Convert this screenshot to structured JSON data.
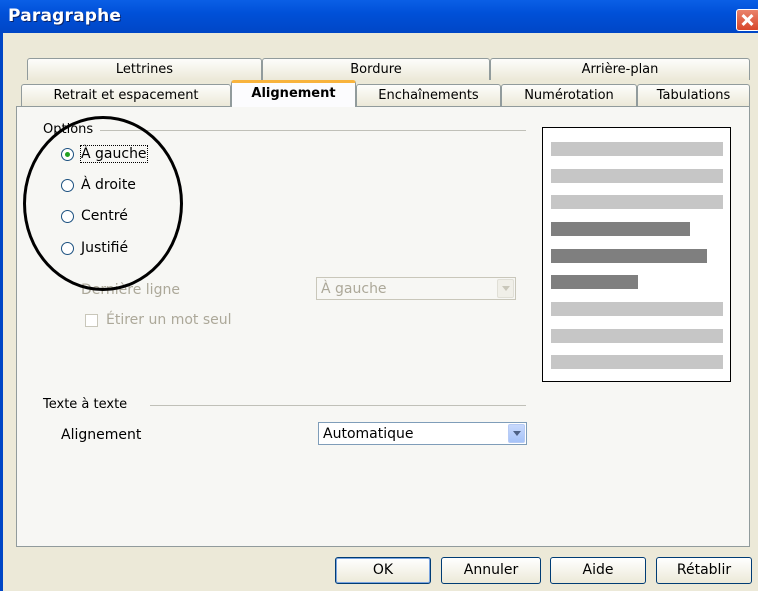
{
  "window": {
    "title": "Paragraphe"
  },
  "tabs_row1": [
    "Lettrines",
    "Bordure",
    "Arrière-plan"
  ],
  "tabs_row2": [
    "Retrait et espacement",
    "Alignement",
    "Enchaînements",
    "Numérotation",
    "Tabulations"
  ],
  "active_tab": "Alignement",
  "options": {
    "section_label": "Options",
    "radios": [
      "À gauche",
      "À droite",
      "Centré",
      "Justifié"
    ],
    "selected": "À gauche",
    "last_line_label": "Dernière ligne",
    "last_line_value": "À gauche",
    "stretch_word_label": "Étirer un mot seul",
    "stretch_word_checked": false
  },
  "text_to_text": {
    "section_label": "Texte à texte",
    "alignment_label": "Alignement",
    "alignment_value": "Automatique"
  },
  "preview": {
    "line_colors": {
      "context": "#c6c6c6",
      "paragraph": "#7f7f7f"
    }
  },
  "buttons": {
    "ok": "OK",
    "cancel": "Annuler",
    "help": "Aide",
    "reset": "Rétablir"
  },
  "colors": {
    "titlebar": "#0050d8",
    "active_tab_accent": "#f8b33c",
    "dialog_bg": "#ece9d8"
  }
}
